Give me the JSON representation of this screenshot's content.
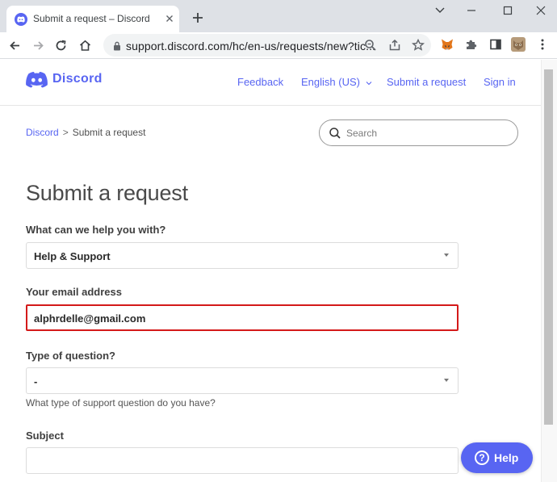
{
  "browser": {
    "tab_title": "Submit a request – Discord",
    "url": "support.discord.com/hc/en-us/requests/new?tic..."
  },
  "header": {
    "logo_text": "Discord",
    "nav": {
      "feedback": "Feedback",
      "language": "English (US)",
      "submit": "Submit a request",
      "signin": "Sign in"
    }
  },
  "breadcrumb": {
    "home": "Discord",
    "separator": ">",
    "current": "Submit a request"
  },
  "search": {
    "placeholder": "Search"
  },
  "form": {
    "title": "Submit a request",
    "help_with": {
      "label": "What can we help you with?",
      "value": "Help & Support"
    },
    "email": {
      "label": "Your email address",
      "value": "alphrdelle@gmail.com"
    },
    "question_type": {
      "label": "Type of question?",
      "value": "-",
      "hint": "What type of support question do you have?"
    },
    "subject": {
      "label": "Subject",
      "value": ""
    }
  },
  "help_button": {
    "label": "Help"
  },
  "colors": {
    "brand": "#5865f2",
    "highlight": "#d41a1a"
  }
}
